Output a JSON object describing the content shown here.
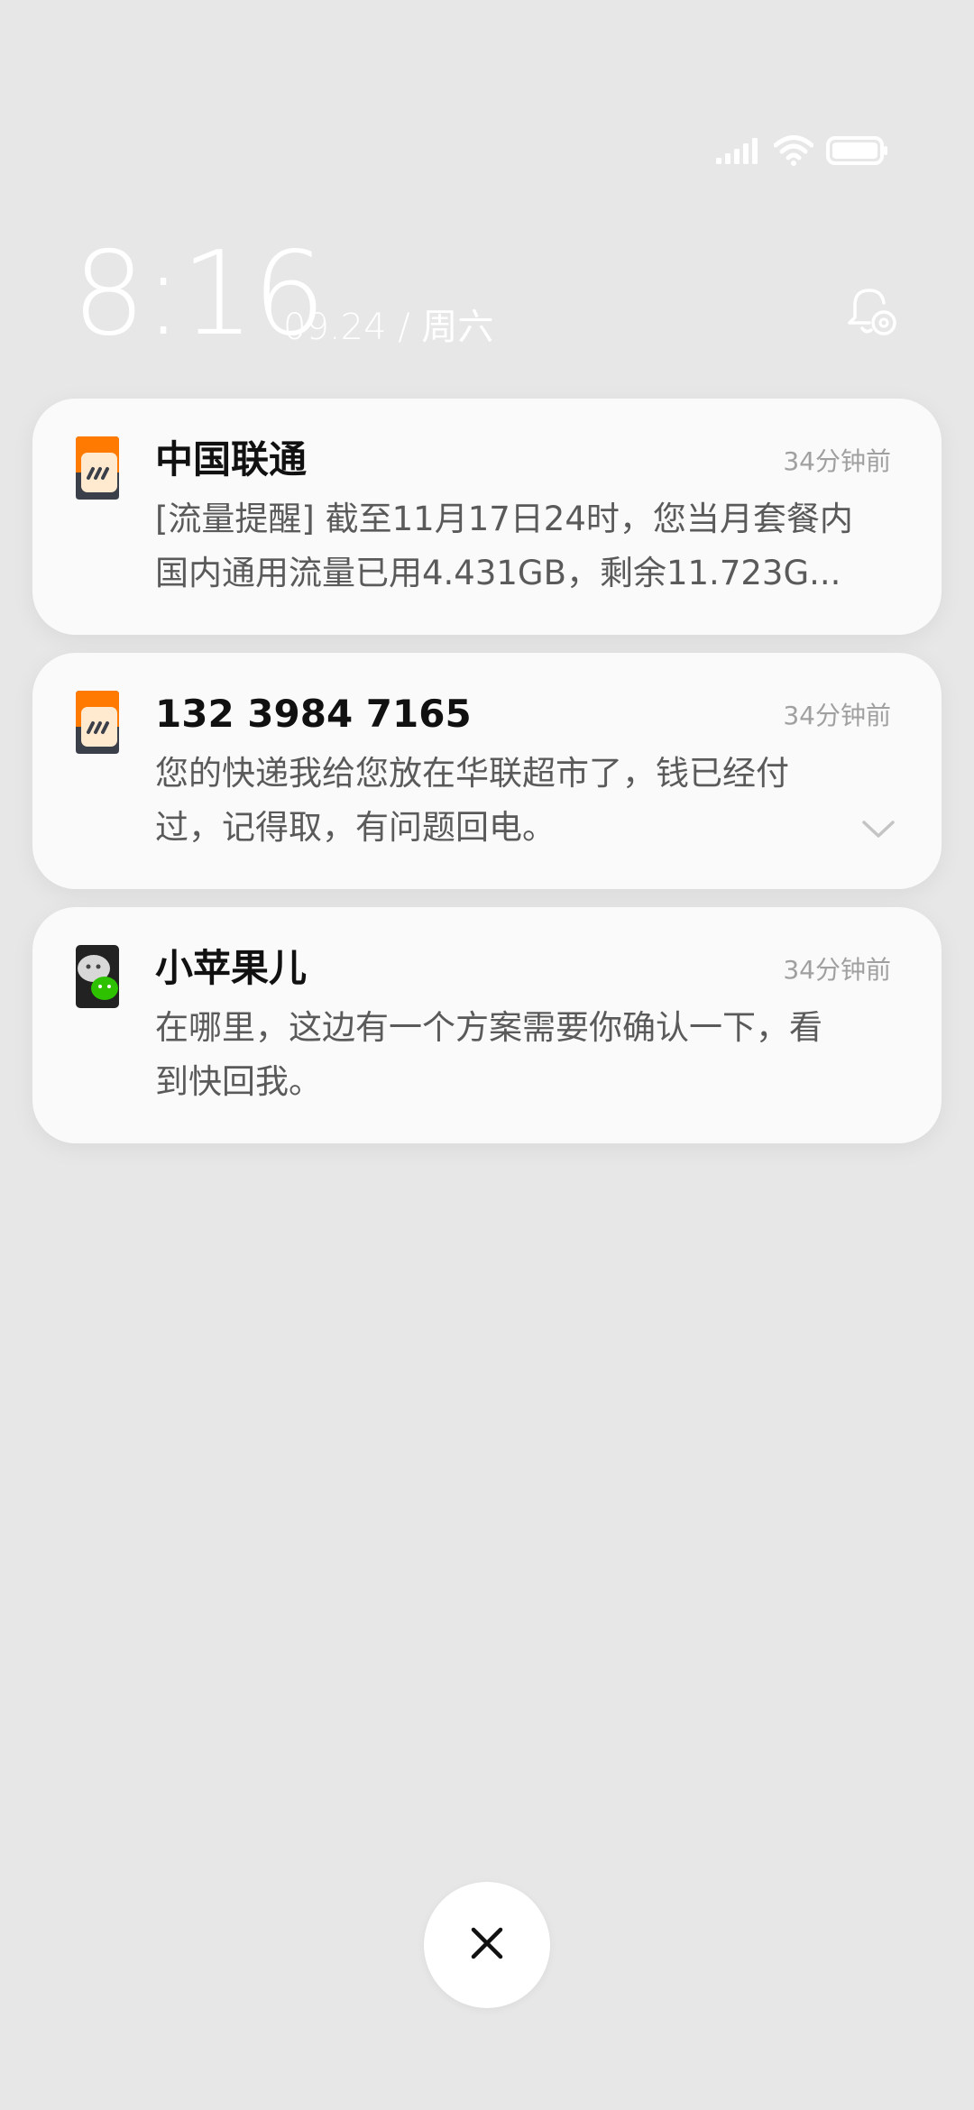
{
  "status_bar": {
    "signal_icon": "signal-icon",
    "wifi_icon": "wifi-icon",
    "battery_icon": "battery-icon"
  },
  "header": {
    "time": "8:16",
    "date": "09.24 / 周六",
    "settings_icon": "notification-settings-icon"
  },
  "notifications": [
    {
      "icon": "sim-card-icon",
      "title": "中国联通",
      "time": "34分钟前",
      "body": "[流量提醒] 截至11月17日24时，您当月套餐内\n国内通用流量已用4.431GB，剩余11.723G..."
    },
    {
      "icon": "sim-card-icon",
      "title": "132 3984 7165",
      "time": "34分钟前",
      "body": "您的快递我给您放在华联超市了，钱已经付\n过，记得取，有问题回电。",
      "expand_icon": "chevron-down-icon"
    },
    {
      "icon": "wechat-icon",
      "title": "小苹果儿",
      "time": "34分钟前",
      "body": "在哪里，这边有一个方案需要你确认一下，看\n到快回我。"
    }
  ],
  "close_button": {
    "icon": "close-icon"
  },
  "colors": {
    "background": "#e7e7e7",
    "card": "#fafafa",
    "sim_orange": "#ff7a00",
    "sim_dark": "#3a3f4a",
    "wechat_green": "#2dc100"
  }
}
